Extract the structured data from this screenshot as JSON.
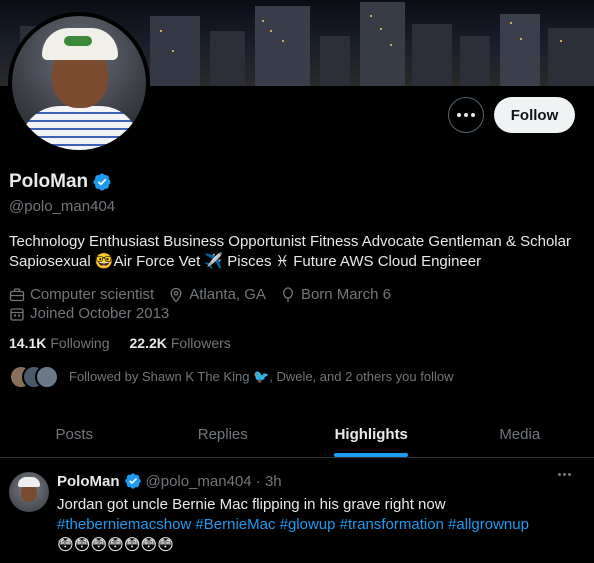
{
  "profile": {
    "display_name": "PoloMan",
    "handle": "@polo_man404",
    "bio": "Technology Enthusiast Business Opportunist Fitness Advocate Gentleman & Scholar Sapiosexual 🤓Air Force Vet ✈️ Pisces ♓ Future AWS Cloud Engineer",
    "verified_icon": "verified-badge-icon",
    "occupation": "Computer scientist",
    "location": "Atlanta, GA",
    "born": "Born March 6",
    "joined": "Joined October 2013"
  },
  "actions": {
    "more_icon": "more-icon",
    "follow_label": "Follow"
  },
  "stats": {
    "following_count": "14.1K",
    "following_label": "Following",
    "followers_count": "22.2K",
    "followers_label": "Followers"
  },
  "followed_by": {
    "text": "Followed by Shawn K The King 🐦, Dwele, and 2 others you follow"
  },
  "tabs": [
    {
      "label": "Posts",
      "active": false
    },
    {
      "label": "Replies",
      "active": false
    },
    {
      "label": "Highlights",
      "active": true
    },
    {
      "label": "Media",
      "active": false
    }
  ],
  "tweet": {
    "name": "PoloMan",
    "handle_time": "@polo_man404 · 3h",
    "text": "Jordan got uncle Bernie Mac flipping in his grave right now",
    "hashtags": "#theberniemacshow #BernieMac #glowup #transformation #allgrownup",
    "emojis": "😳😳😳😳😳😳😳"
  },
  "colors": {
    "accent": "#1d9bf0",
    "background": "#000000",
    "text_primary": "#e7e9ea",
    "text_secondary": "#71767b"
  }
}
